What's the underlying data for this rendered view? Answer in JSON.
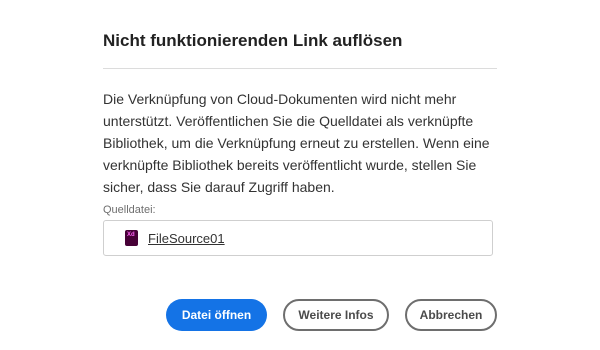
{
  "dialog": {
    "title": "Nicht funktionierenden Link auflösen",
    "message": "Die Verknüpfung von Cloud-Dokumenten wird nicht mehr unterstützt. Veröffentlichen Sie die Quelldatei als verknüpfte Bibliothek, um die Verknüpfung erneut zu erstellen. Wenn eine verknüpfte Bibliothek bereits veröffentlicht wurde, stellen Sie sicher, dass Sie darauf Zugriff haben.",
    "source_label": "Quelldatei:",
    "source_file": {
      "name": "FileSource01",
      "icon": "xd-file-icon",
      "icon_text": "Xd"
    }
  },
  "buttons": {
    "open_label": "Datei öffnen",
    "more_info_label": "Weitere Infos",
    "cancel_label": "Abbrechen"
  },
  "colors": {
    "primary": "#1473e6",
    "xd_icon_bg": "#470137",
    "xd_icon_text": "#ff61f6"
  }
}
